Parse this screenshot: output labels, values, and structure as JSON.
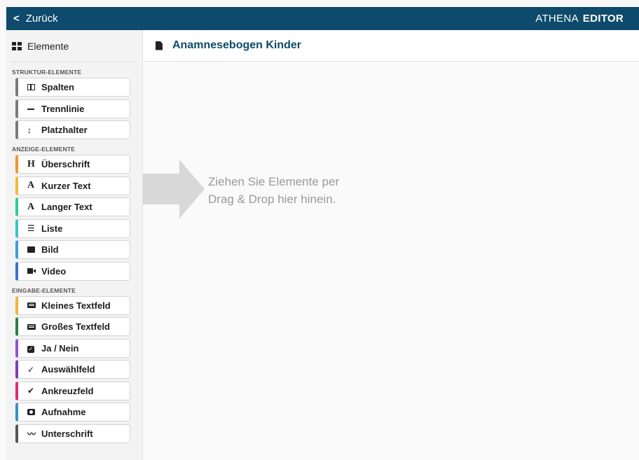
{
  "topbar": {
    "back_label": "Zurück",
    "brand_light": "ATHENA",
    "brand_bold": "EDITOR",
    "bg_color": "#0d4a6b"
  },
  "sidebar": {
    "header": "Elemente",
    "sections": [
      {
        "title": "STRUKTUR-ELEMENTE",
        "items": [
          {
            "label": "Spalten",
            "icon": "columns-icon",
            "color": "#7a7a7a"
          },
          {
            "label": "Trennlinie",
            "icon": "minus-icon",
            "color": "#7a7a7a"
          },
          {
            "label": "Platzhalter",
            "icon": "vertical-arrows-icon",
            "color": "#7a7a7a"
          }
        ]
      },
      {
        "title": "ANZEIGE-ELEMENTE",
        "items": [
          {
            "label": "Überschrift",
            "icon": "heading-icon",
            "glyph": "H",
            "color": "#f0962e"
          },
          {
            "label": "Kurzer Text",
            "icon": "font-icon",
            "glyph": "A",
            "color": "#f2b93b"
          },
          {
            "label": "Langer Text",
            "icon": "font-icon",
            "glyph": "A",
            "color": "#2fcf8e"
          },
          {
            "label": "Liste",
            "icon": "list-icon",
            "glyph": "☰",
            "color": "#3cc3c8"
          },
          {
            "label": "Bild",
            "icon": "image-icon",
            "color": "#3aa0dc"
          },
          {
            "label": "Video",
            "icon": "video-icon",
            "color": "#3c6fd6"
          }
        ]
      },
      {
        "title": "EINGABE-ELEMENTE",
        "items": [
          {
            "label": "Kleines Textfeld",
            "icon": "keyboard-icon",
            "color": "#f2b63b"
          },
          {
            "label": "Großes Textfeld",
            "icon": "keyboard-icon",
            "color": "#2e7d4a"
          },
          {
            "label": "Ja / Nein",
            "icon": "checkbox-icon",
            "color": "#8e54d6"
          },
          {
            "label": "Auswählfeld",
            "icon": "check-icon",
            "glyph": "✓",
            "color": "#7b3fb5"
          },
          {
            "label": "Ankreuzfeld",
            "icon": "double-check-icon",
            "glyph": "✔",
            "color": "#e0297a"
          },
          {
            "label": "Aufnahme",
            "icon": "camera-icon",
            "color": "#3a8fbf"
          },
          {
            "label": "Unterschrift",
            "icon": "signature-icon",
            "glyph": "〰",
            "color": "#555555"
          }
        ]
      }
    ]
  },
  "main": {
    "title": "Anamnesebogen Kinder",
    "drop_hint_line1": "Ziehen Sie Elemente per",
    "drop_hint_line2": "Drag & Drop hier hinein."
  }
}
